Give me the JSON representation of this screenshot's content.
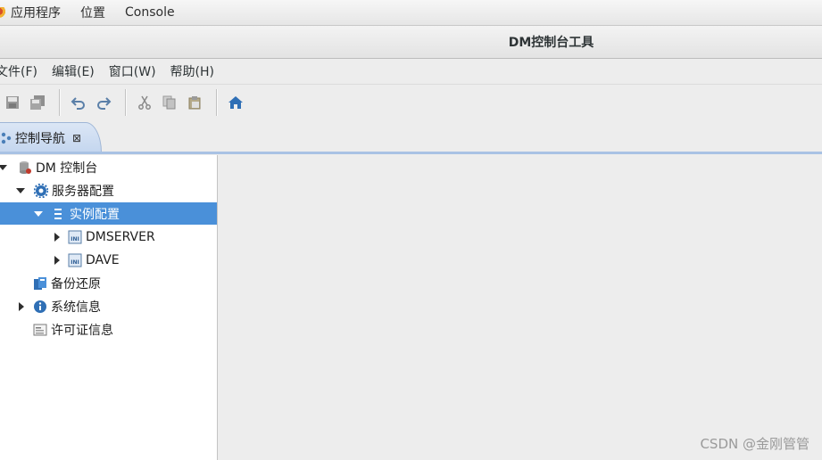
{
  "top_panel": {
    "applications": "应用程序",
    "places": "位置",
    "console": "Console"
  },
  "window": {
    "title": "DM控制台工具"
  },
  "menu": {
    "items": [
      "文件(F)",
      "编辑(E)",
      "窗口(W)",
      "帮助(H)"
    ]
  },
  "toolbar": {
    "buttons": [
      "save-icon",
      "save-all-icon",
      "undo-icon",
      "redo-icon",
      "cut-icon",
      "copy-icon",
      "paste-icon",
      "home-icon"
    ]
  },
  "tab": {
    "label": "控制导航",
    "close": "⊠"
  },
  "tree": {
    "root": "DM 控制台",
    "server_config": "服务器配置",
    "instance_config": "实例配置",
    "instances": [
      "DMSERVER",
      "DAVE"
    ],
    "backup_restore": "备份还原",
    "system_info": "系统信息",
    "license_info": "许可证信息"
  },
  "watermark": "CSDN @金刚管管",
  "colors": {
    "selection": "#4a90d9",
    "tab_accent": "#a9c2e4",
    "home_icon": "#2f6fb5"
  }
}
